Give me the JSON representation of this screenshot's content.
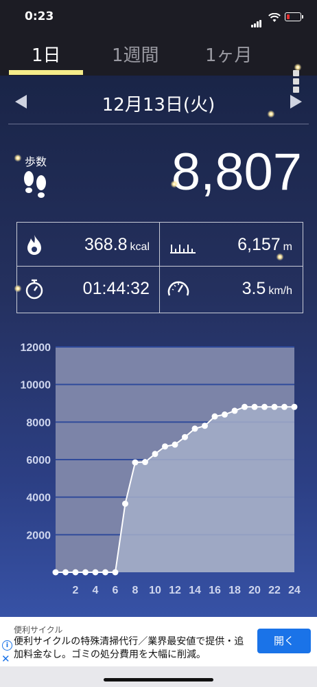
{
  "status_bar": {
    "time": "0:23"
  },
  "tabs": [
    {
      "label": "1日",
      "active": true
    },
    {
      "label": "1週間",
      "active": false
    },
    {
      "label": "1ヶ月",
      "active": false
    }
  ],
  "date": {
    "label": "12月13日(火)"
  },
  "steps": {
    "label": "歩数",
    "value": "8,807"
  },
  "stats": {
    "calories": {
      "value": "368.8",
      "unit": "kcal",
      "icon": "flame-icon"
    },
    "distance": {
      "value": "6,157",
      "unit": "m",
      "icon": "ruler-icon"
    },
    "duration": {
      "value": "01:44:32",
      "unit": "",
      "icon": "stopwatch-icon"
    },
    "speed": {
      "value": "3.5",
      "unit": "km/h",
      "icon": "speedometer-icon"
    }
  },
  "chart_data": {
    "type": "area",
    "x": [
      0,
      1,
      2,
      3,
      4,
      5,
      6,
      7,
      8,
      9,
      10,
      11,
      12,
      13,
      14,
      15,
      16,
      17,
      18,
      19,
      20,
      21,
      22,
      23,
      24
    ],
    "series": [
      {
        "values": [
          0,
          0,
          0,
          0,
          0,
          0,
          0,
          3650,
          5850,
          5870,
          6300,
          6700,
          6800,
          7200,
          7650,
          7800,
          8300,
          8400,
          8600,
          8807,
          8807,
          8807,
          8807,
          8807,
          8807
        ]
      }
    ],
    "x_tick_labels": [
      "2",
      "4",
      "6",
      "8",
      "10",
      "12",
      "14",
      "16",
      "18",
      "20",
      "22",
      "24"
    ],
    "y_tick_labels": [
      "2000",
      "4000",
      "6000",
      "8000",
      "10000",
      "12000"
    ],
    "xlim": [
      0,
      24
    ],
    "ylim": [
      0,
      12000
    ],
    "grid": true,
    "colors": {
      "area": "#a4aec9",
      "line": "#ffffff",
      "point": "#ffffff",
      "plot_bg": "#7c84a8",
      "grid": "#2f4a9a"
    }
  },
  "ad": {
    "sponsor": "便利サイクル",
    "text": "便利サイクルの特殊清掃代行／業界最安値で提供・追加料金なし。ゴミの処分費用を大幅に削減。",
    "button_label": "開く",
    "info_icon": "i",
    "close_icon": "✕"
  }
}
